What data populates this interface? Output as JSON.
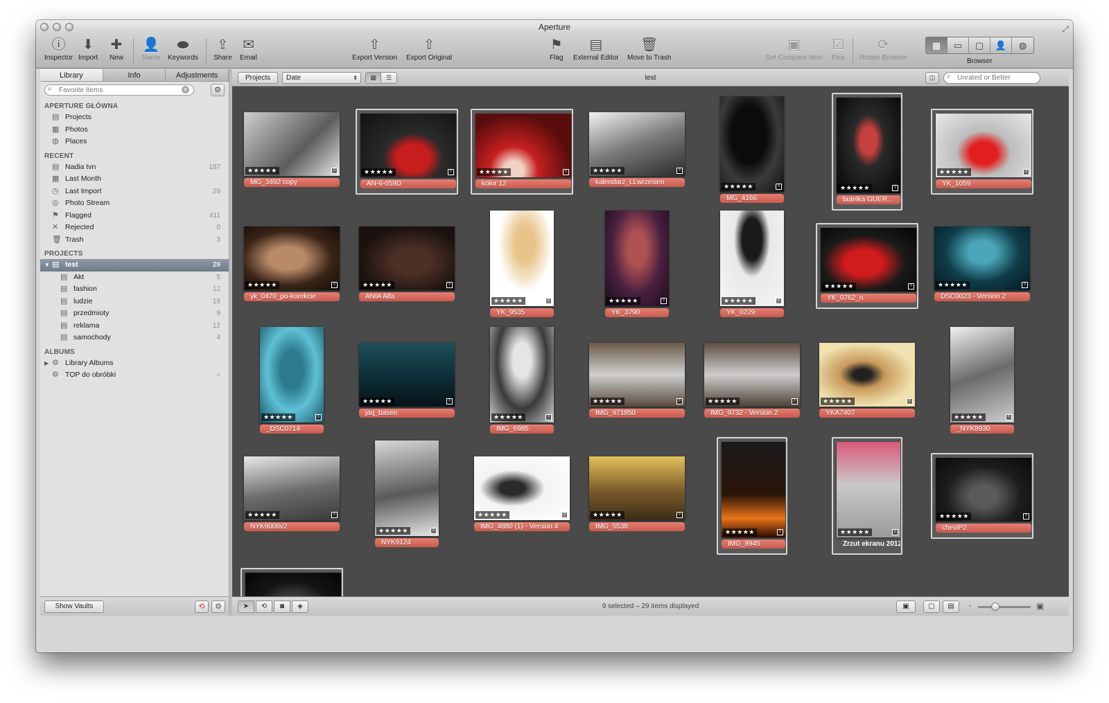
{
  "window": {
    "title": "Aperture"
  },
  "toolbar": {
    "inspector": "Inspector",
    "import": "Import",
    "new": "New",
    "name": "Name",
    "keywords": "Keywords",
    "share": "Share",
    "email": "Email",
    "export_version": "Export Version",
    "export_original": "Export Original",
    "flag": "Flag",
    "external_editor": "External Editor",
    "move_to_trash": "Move to Trash",
    "set_compare_item": "Set Compare Item",
    "pick": "Pick",
    "rotate_browser": "Rotate Browser",
    "browser": "Browser"
  },
  "left_panel": {
    "tabs": [
      "Library",
      "Info",
      "Adjustments"
    ],
    "search_placeholder": "Favorite Items",
    "sections": {
      "library_head": "APERTURE GŁÓWNA",
      "recent_head": "RECENT",
      "projects_head": "PROJECTS",
      "albums_head": "ALBUMS"
    },
    "library_items": [
      "Projects",
      "Photos",
      "Places"
    ],
    "recent_items": [
      {
        "label": "Nadia tvn",
        "count": "187"
      },
      {
        "label": "Last Month",
        "count": ""
      },
      {
        "label": "Last Import",
        "count": "29"
      },
      {
        "label": "Photo Stream",
        "count": ""
      },
      {
        "label": "Flagged",
        "count": "411"
      },
      {
        "label": "Rejected",
        "count": "0"
      },
      {
        "label": "Trash",
        "count": "3"
      }
    ],
    "project": {
      "label": "test",
      "count": "29"
    },
    "project_children": [
      {
        "label": "Akt",
        "count": "5"
      },
      {
        "label": "fashion",
        "count": "12"
      },
      {
        "label": "ludzie",
        "count": "19"
      },
      {
        "label": "przedmioty",
        "count": "9"
      },
      {
        "label": "reklama",
        "count": "12"
      },
      {
        "label": "samochody",
        "count": "4"
      }
    ],
    "albums": [
      "Library Albums",
      "TOP do obróbki"
    ],
    "show_vaults": "Show Vaults"
  },
  "browser": {
    "projects_button": "Projects",
    "sort_value": "Date",
    "title": "test",
    "filter_value": "Unrated or Better",
    "status": "9 selected – 29 items displayed",
    "stars": "★★★★★",
    "items": [
      {
        "name": "MG_3492 copy"
      },
      {
        "name": "AN-6-059D"
      },
      {
        "name": "kolor 12"
      },
      {
        "name": "kalendarz_LLwrzesien"
      },
      {
        "name": "MG_4166"
      },
      {
        "name": "butelka GUER..."
      },
      {
        "name": "YK_1059"
      },
      {
        "name": "yk_0470_po-korekcie"
      },
      {
        "name": "ANIA Alfa"
      },
      {
        "name": "YK_9535"
      },
      {
        "name": "YK_3790"
      },
      {
        "name": "YK_0229"
      },
      {
        "name": "YK_0762_n"
      },
      {
        "name": "DSC0023 - Version 2"
      },
      {
        "name": "_DSC0714"
      },
      {
        "name": "jaq_basen"
      },
      {
        "name": "IMG_6985"
      },
      {
        "name": "IMG_971850"
      },
      {
        "name": "IMG_9732 - Version 2"
      },
      {
        "name": "YKA7407"
      },
      {
        "name": "_NYK8930"
      },
      {
        "name": "NYK9008v2"
      },
      {
        "name": "NYK9124"
      },
      {
        "name": "IMG_4880 (1) - Version 4"
      },
      {
        "name": "IMG_5538"
      },
      {
        "name": "IMG_8945"
      },
      {
        "name": "Zrzut ekranu 2012-..."
      },
      {
        "name": "cheviP2"
      },
      {
        "name": ""
      }
    ]
  }
}
